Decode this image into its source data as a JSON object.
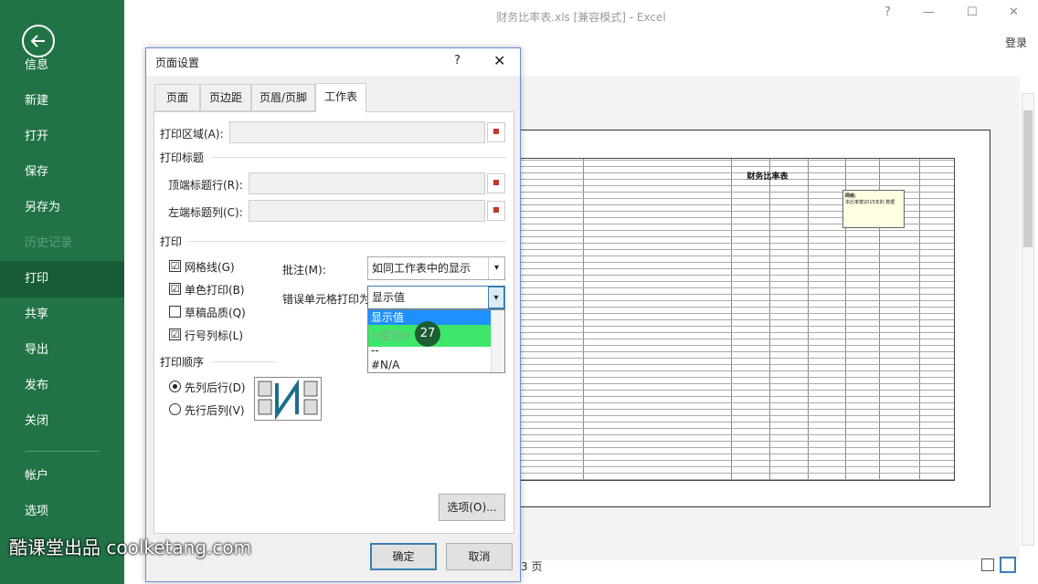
{
  "window": {
    "title": "财务比率表.xls  [兼容模式] - Excel",
    "login": "登录",
    "help": "?",
    "minimize": "—",
    "restore": "☐",
    "close": "✕"
  },
  "sidebar": {
    "items": [
      {
        "label": "信息"
      },
      {
        "label": "新建"
      },
      {
        "label": "打开"
      },
      {
        "label": "保存"
      },
      {
        "label": "另存为"
      },
      {
        "label": "历史记录"
      },
      {
        "label": "打印"
      },
      {
        "label": "共享"
      },
      {
        "label": "导出"
      },
      {
        "label": "发布"
      },
      {
        "label": "关闭"
      },
      {
        "label": "帐户"
      },
      {
        "label": "选项"
      }
    ]
  },
  "preview": {
    "sheet_title": "财务比率表",
    "note_title": "网络:",
    "note_text": "本比率按2015年的 数据",
    "page_label": "3 页"
  },
  "dialog": {
    "title": "页面设置",
    "help": "?",
    "close": "✕",
    "tabs": [
      {
        "label": "页面"
      },
      {
        "label": "页边距"
      },
      {
        "label": "页眉/页脚"
      },
      {
        "label": "工作表"
      }
    ],
    "print_area_label": "打印区域(A):",
    "print_titles_group": "打印标题",
    "top_rows_label": "顶端标题行(R):",
    "left_cols_label": "左端标题列(C):",
    "print_group": "打印",
    "checks": [
      {
        "label": "网格线(G)",
        "mark": "☑"
      },
      {
        "label": "单色打印(B)",
        "mark": "☑"
      },
      {
        "label": "草稿品质(Q)",
        "mark": ""
      },
      {
        "label": "行号列标(L)",
        "mark": "☑"
      }
    ],
    "comments_label": "批注(M):",
    "comments_value": "如同工作表中的显示",
    "errors_label": "错误单元格打印为(E):",
    "errors_value": "显示值",
    "dropdown_options": [
      {
        "label": "显示值"
      },
      {
        "label": "<空白>"
      },
      {
        "label": "--"
      },
      {
        "label": "#N/A"
      }
    ],
    "order_group": "打印顺序",
    "order_options": [
      {
        "label": "先列后行(D)"
      },
      {
        "label": "先行后列(V)"
      }
    ],
    "options_button": "选项(O)...",
    "ok_button": "确定",
    "cancel_button": "取消"
  },
  "step_badge": "27",
  "watermark": "酷课堂出品 coolketang.com",
  "colors": {
    "sidebar": "#217346",
    "sidebar_selected": "#185c37",
    "highlight": "#1e90ff",
    "green_option": "#3ee66a",
    "badge": "#1e5e34"
  }
}
